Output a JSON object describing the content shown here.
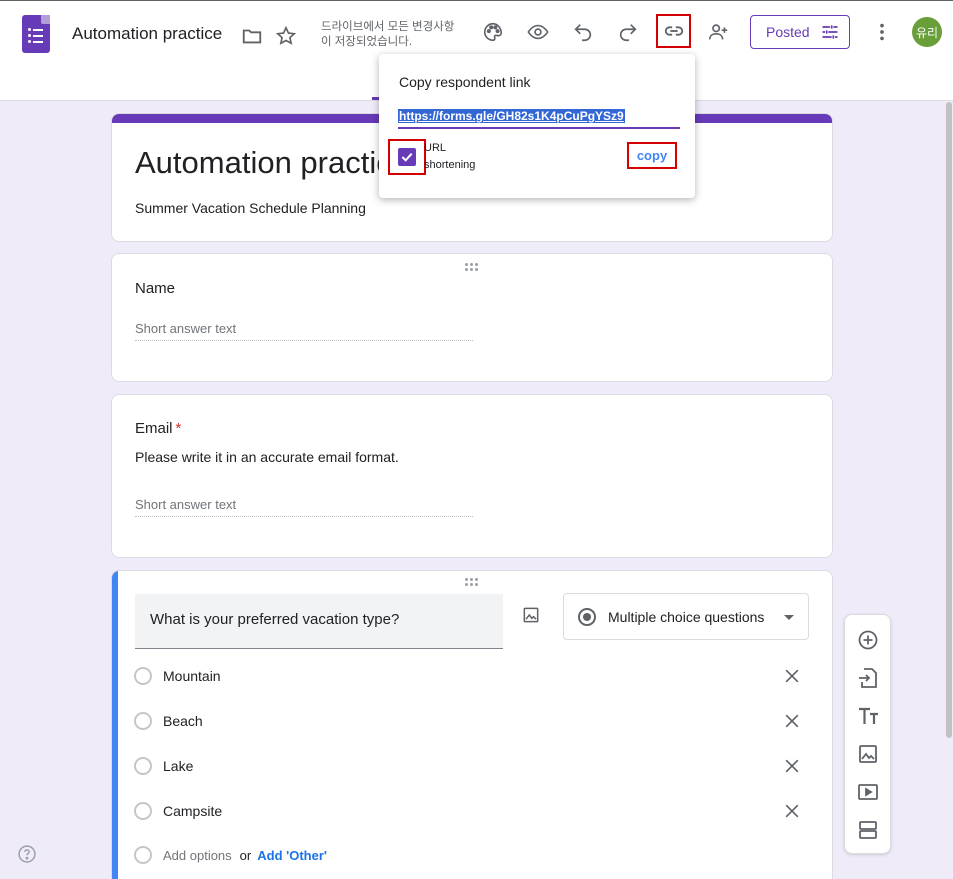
{
  "header": {
    "app_title": "Automation practice",
    "save_status": "드라이브에서 모든 변경사항이 저장되었습니다.",
    "posted_label": "Posted",
    "avatar_text": "유리"
  },
  "form": {
    "title": "Automation practice",
    "description": "Summer Vacation Schedule Planning"
  },
  "questions": [
    {
      "title": "Name",
      "placeholder": "Short answer text"
    },
    {
      "title": "Email",
      "required_mark": "*",
      "help": "Please write it in an accurate email format.",
      "placeholder": "Short answer text"
    }
  ],
  "active_question": {
    "title": "What is your preferred vacation type?",
    "type_label": "Multiple choice questions",
    "options": [
      "Mountain",
      "Beach",
      "Lake",
      "Campsite"
    ],
    "add_option": "Add options",
    "or": "or",
    "add_other": "Add 'Other'"
  },
  "popup": {
    "title": "Copy respondent link",
    "link": "https://forms.gle/GH82s1K4pCuPgYSz9",
    "url_shortening_label_1": "URL",
    "url_shortening_label_2": "shortening",
    "url_shortening_checked": true,
    "copy_label": "copy"
  },
  "colors": {
    "accent": "#673ab7",
    "background": "#f0ebf8",
    "active_bar": "#4285f4",
    "highlight_box": "#d50000",
    "avatar": "#689f38"
  },
  "side_tools": [
    "add-question-icon",
    "import-questions-icon",
    "title-text-icon",
    "add-image-icon",
    "add-video-icon",
    "add-section-icon"
  ]
}
